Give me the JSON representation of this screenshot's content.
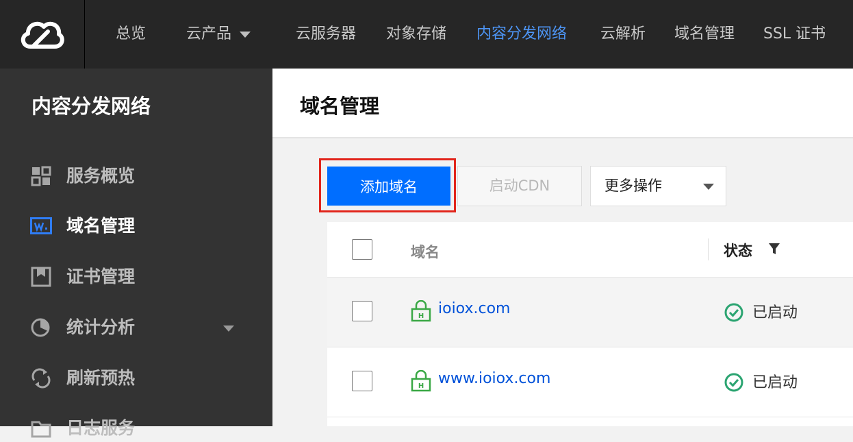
{
  "topnav": {
    "items": [
      {
        "label": "总览"
      },
      {
        "label": "云产品"
      },
      {
        "label": "云服务器"
      },
      {
        "label": "对象存储"
      },
      {
        "label": "内容分发网络"
      },
      {
        "label": "云解析"
      },
      {
        "label": "域名管理"
      },
      {
        "label": "SSL 证书"
      }
    ],
    "active_index": 4
  },
  "sidebar": {
    "title": "内容分发网络",
    "items": [
      {
        "label": "服务概览",
        "icon": "grid-icon"
      },
      {
        "label": "域名管理",
        "icon": "domain-w-icon",
        "active": true
      },
      {
        "label": "证书管理",
        "icon": "certificate-icon"
      },
      {
        "label": "统计分析",
        "icon": "pie-chart-icon",
        "expandable": true
      },
      {
        "label": "刷新预热",
        "icon": "refresh-icon"
      },
      {
        "label": "日志服务",
        "icon": "folder-icon"
      }
    ]
  },
  "main": {
    "title": "域名管理",
    "toolbar": {
      "add_label": "添加域名",
      "cdn_label": "启动CDN",
      "more_label": "更多操作"
    },
    "table": {
      "headers": {
        "domain": "域名",
        "status": "状态"
      },
      "rows": [
        {
          "domain": "ioiox.com",
          "status": "已启动"
        },
        {
          "domain": "www.ioiox.com",
          "status": "已启动"
        }
      ]
    }
  },
  "colors": {
    "topbar_bg": "#262626",
    "sidebar_bg": "#333333",
    "accent": "#006eff",
    "active_nav": "#4d95f5",
    "highlight": "#e1251b",
    "success": "#2ba471"
  }
}
